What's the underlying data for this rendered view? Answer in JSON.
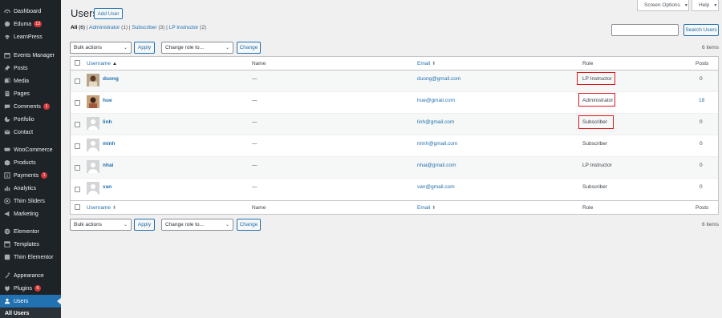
{
  "sidebar": {
    "items": [
      {
        "label": "Dashboard",
        "icon": "dashboard-icon"
      },
      {
        "label": "Eduma",
        "icon": "eduma-icon",
        "badge": "12"
      },
      {
        "label": "LearnPress",
        "icon": "learnpress-icon"
      },
      {
        "label": "Events Manager",
        "icon": "calendar-icon"
      },
      {
        "label": "Posts",
        "icon": "pin-icon"
      },
      {
        "label": "Media",
        "icon": "media-icon"
      },
      {
        "label": "Pages",
        "icon": "page-icon"
      },
      {
        "label": "Comments",
        "icon": "comment-icon",
        "badge": "1"
      },
      {
        "label": "Portfolio",
        "icon": "portfolio-icon"
      },
      {
        "label": "Contact",
        "icon": "mail-icon"
      },
      {
        "label": "WooCommerce",
        "icon": "woocommerce-icon"
      },
      {
        "label": "Products",
        "icon": "products-icon"
      },
      {
        "label": "Payments",
        "icon": "payments-icon",
        "badge": "1"
      },
      {
        "label": "Analytics",
        "icon": "analytics-icon"
      },
      {
        "label": "Thim Sliders",
        "icon": "slider-icon"
      },
      {
        "label": "Marketing",
        "icon": "megaphone-icon"
      },
      {
        "label": "Elementor",
        "icon": "elementor-icon"
      },
      {
        "label": "Templates",
        "icon": "templates-icon"
      },
      {
        "label": "Thim Elementor",
        "icon": "thim-elementor-icon"
      },
      {
        "label": "Appearance",
        "icon": "appearance-icon"
      },
      {
        "label": "Plugins",
        "icon": "plugin-icon",
        "badge": "6"
      },
      {
        "label": "Users",
        "icon": "users-icon"
      }
    ],
    "submenu": {
      "all_users": "All Users"
    }
  },
  "header": {
    "title": "Users",
    "add_user": "Add User",
    "screen_options": "Screen Options",
    "help": "Help"
  },
  "filters": {
    "all": "All",
    "all_count": "(6)",
    "administrator": "Administrator",
    "administrator_count": "(1)",
    "subscriber": "Subscriber",
    "subscriber_count": "(3)",
    "lp_instructor": "LP Instructor",
    "lp_instructor_count": "(2)",
    "sep": "|"
  },
  "search": {
    "value": "",
    "button": "Search Users"
  },
  "bulk": {
    "selected": "Bulk actions",
    "apply": "Apply",
    "role_selected": "Change role to...",
    "change": "Change"
  },
  "items_count": "6 items",
  "table": {
    "columns": {
      "username": "Username",
      "name": "Name",
      "email": "Email",
      "role": "Role",
      "posts": "Posts"
    },
    "sort_icon": "⬍",
    "rows": [
      {
        "username": "duong",
        "name": "—",
        "email": "duong@gmail.com",
        "role": "LP Instructor",
        "posts": "0"
      },
      {
        "username": "hue",
        "name": "—",
        "email": "hue@gmail.com",
        "role": "Administrator",
        "posts": "18"
      },
      {
        "username": "linh",
        "name": "—",
        "email": "linh@gmail.com",
        "role": "Subscriber",
        "posts": "0"
      },
      {
        "username": "minh",
        "name": "—",
        "email": "minh@gmail.com",
        "role": "Subscriber",
        "posts": "0"
      },
      {
        "username": "nhai",
        "name": "—",
        "email": "nhai@gmail.com",
        "role": "LP Instructor",
        "posts": "0"
      },
      {
        "username": "van",
        "name": "—",
        "email": "van@gmail.com",
        "role": "Subscriber",
        "posts": "0"
      }
    ]
  },
  "colors": {
    "accent": "#2271b1",
    "sidebar": "#1d2327",
    "highlight": "#e1141b",
    "badge": "#d63638"
  }
}
